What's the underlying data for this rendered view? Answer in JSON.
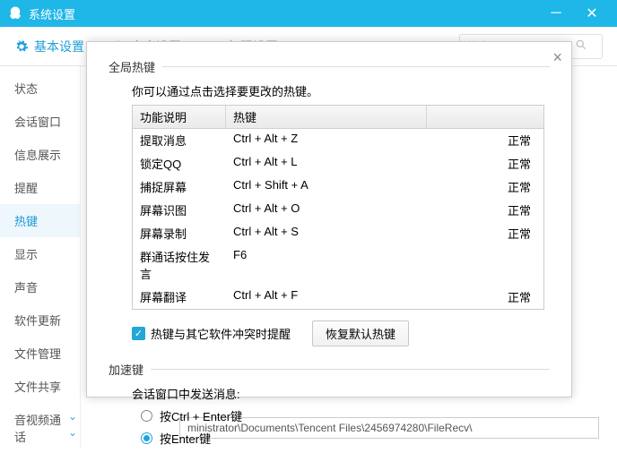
{
  "window": {
    "title": "系统设置"
  },
  "tabs": {
    "basic": "基本设置",
    "security": "安全设置",
    "privilege": "权限设置"
  },
  "search": {
    "placeholder": "搜索设置项"
  },
  "sidebar": {
    "items": [
      "状态",
      "会话窗口",
      "信息展示",
      "提醒",
      "热键",
      "显示",
      "声音",
      "软件更新",
      "文件管理",
      "文件共享",
      "音视频通话"
    ],
    "active_index": 4
  },
  "bg": {
    "path": "ministrator\\Documents\\Tencent Files\\2456974280\\FileRecv\\"
  },
  "dialog": {
    "section1": "全局热键",
    "tip": "你可以通过点击选择要更改的热键。",
    "headers": {
      "a": "功能说明",
      "b": "热键",
      "c": ""
    },
    "rows": [
      {
        "a": "提取消息",
        "b": "Ctrl + Alt + Z",
        "c": "正常"
      },
      {
        "a": "锁定QQ",
        "b": "Ctrl + Alt + L",
        "c": "正常"
      },
      {
        "a": "捕捉屏幕",
        "b": "Ctrl + Shift + A",
        "c": "正常"
      },
      {
        "a": "屏幕识图",
        "b": "Ctrl + Alt + O",
        "c": "正常"
      },
      {
        "a": "屏幕录制",
        "b": "Ctrl + Alt + S",
        "c": "正常"
      },
      {
        "a": "群通话按住发言",
        "b": "F6",
        "c": ""
      },
      {
        "a": "屏幕翻译",
        "b": "Ctrl + Alt + F",
        "c": "正常"
      }
    ],
    "conflict_label": "热键与其它软件冲突时提醒",
    "restore_btn": "恢复默认热键",
    "section2": "加速键",
    "send_label": "会话窗口中发送消息:",
    "opt_ctrl_enter": "按Ctrl + Enter键",
    "opt_enter": "按Enter键"
  }
}
